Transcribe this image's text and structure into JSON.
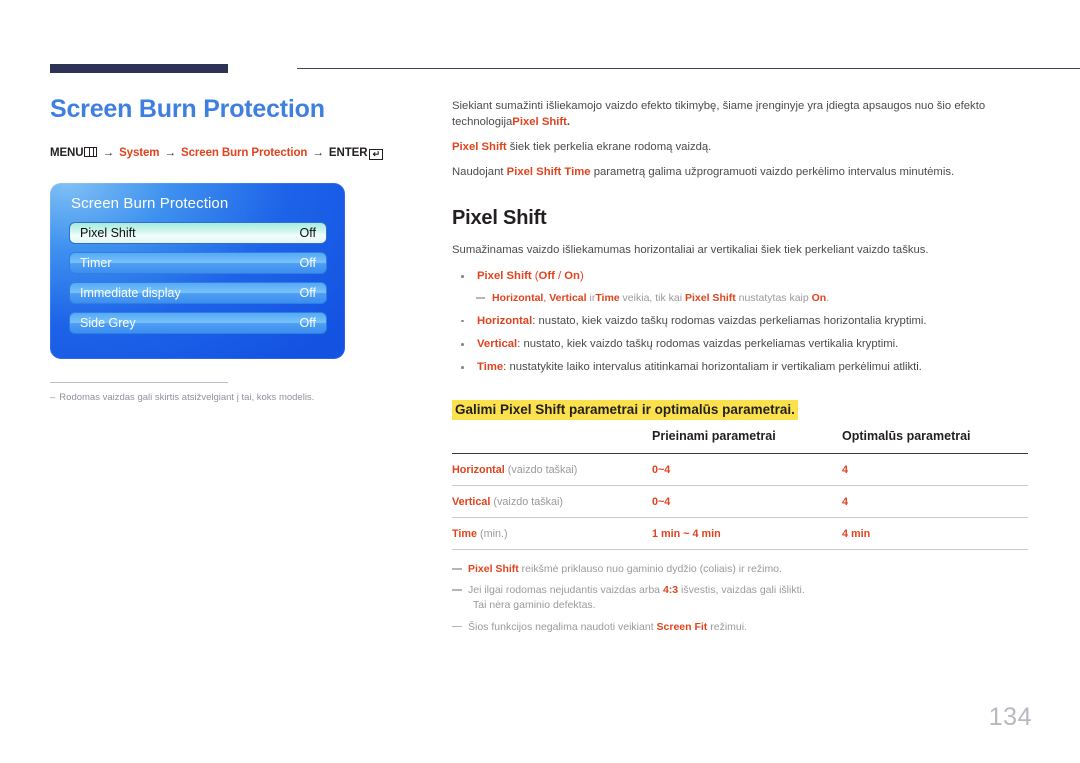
{
  "page": {
    "number": "134",
    "title": "Screen Burn Protection"
  },
  "breadcrumb": {
    "menu_label": "MENU",
    "arrow": "→",
    "item1": "System",
    "item2": "Screen Burn Protection",
    "enter_label": "ENTER",
    "enter_glyph": "↵"
  },
  "osd": {
    "title": "Screen Burn Protection",
    "rows": [
      {
        "label": "Pixel Shift",
        "value": "Off",
        "selected": true
      },
      {
        "label": "Timer",
        "value": "Off",
        "selected": false
      },
      {
        "label": "Immediate display",
        "value": "Off",
        "selected": false
      },
      {
        "label": "Side Grey",
        "value": "Off",
        "selected": false
      }
    ]
  },
  "left_note": {
    "dash": "–",
    "text": "Rodomas vaizdas gali skirtis atsižvelgiant į tai, koks modelis."
  },
  "intro": {
    "p1_a": "Siekiant sumažinti išliekamojo vaizdo efekto tikimybę, šiame įrenginyje yra įdiegta apsaugos nuo šio efekto technologija",
    "p1_b": "Pixel Shift",
    "p1_c": ".",
    "p2_a": "Pixel Shift",
    "p2_b": " šiek tiek perkelia ekrane rodomą vaizdą.",
    "p3_a": "Naudojant ",
    "p3_b": "Pixel Shift Time",
    "p3_c": " parametrą galima užprogramuoti vaizdo perkėlimo intervalus minutėmis."
  },
  "section": {
    "title": "Pixel Shift",
    "desc": "Sumažinamas vaizdo išliekamumas horizontaliai ar vertikaliai šiek tiek perkeliant vaizdo taškus.",
    "bullet1_name": "Pixel Shift",
    "bullet1_opts_open": " (",
    "bullet1_opt_off": "Off",
    "bullet1_sep": " / ",
    "bullet1_opt_on": "On",
    "bullet1_opts_close": ")",
    "subnote1_a": "Horizontal",
    "subnote1_b": ", ",
    "subnote1_c": "Vertical",
    "subnote1_d": " ir",
    "subnote1_e": "Time",
    "subnote1_f": " veikia, tik kai ",
    "subnote1_g": "Pixel Shift",
    "subnote1_h": " nustatytas kaip ",
    "subnote1_i": "On",
    "subnote1_j": ".",
    "bullet2_name": "Horizontal",
    "bullet2_text": ": nustato, kiek vaizdo taškų rodomas vaizdas perkeliamas horizontalia kryptimi.",
    "bullet3_name": "Vertical",
    "bullet3_text": ": nustato, kiek vaizdo taškų rodomas vaizdas perkeliamas vertikalia kryptimi.",
    "bullet4_name": "Time",
    "bullet4_text": ": nustatykite laiko intervalus atitinkamai horizontaliam ir vertikaliam perkėlimui atlikti."
  },
  "table": {
    "heading": "Galimi Pixel Shift parametrai ir optimalūs parametrai.",
    "headers": [
      "",
      "Prieinami parametrai",
      "Optimalūs parametrai"
    ],
    "rows": [
      {
        "name": "Horizontal",
        "unit": " (vaizdo taškai)",
        "available": "0~4",
        "optimal": "4"
      },
      {
        "name": "Vertical",
        "unit": " (vaizdo taškai)",
        "available": "0~4",
        "optimal": "4"
      },
      {
        "name": "Time",
        "unit": " (min.)",
        "available": "1 min ~ 4 min",
        "optimal": "4 min"
      }
    ]
  },
  "tail_notes": {
    "n1_a": "Pixel Shift",
    "n1_b": " reikšmė priklauso nuo gaminio dydžio (coliais) ir režimo.",
    "n2_a": "Jei ilgai rodomas nejudantis vaizdas arba ",
    "n2_b": "4:3",
    "n2_c": " išvestis, vaizdas gali išlikti.",
    "n2_d": "Tai nėra gaminio defektas.",
    "n3_a": "Šios funkcijos negalima naudoti veikiant ",
    "n3_b": "Screen Fit",
    "n3_c": " režimui."
  },
  "colors": {
    "title_blue": "#3f7fe0",
    "accent_red": "#e1431e",
    "highlight_yellow": "#fbe24d",
    "rule_navy": "#2e3356",
    "osd_blue": "#1d63e8"
  }
}
